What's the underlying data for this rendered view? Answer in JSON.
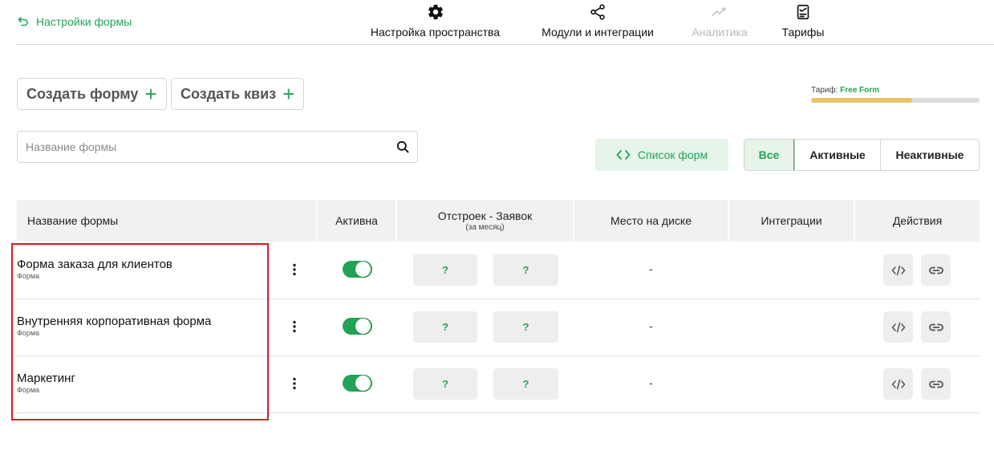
{
  "header": {
    "back_label": "Настройки формы",
    "nav": [
      {
        "label": "Настройка пространства",
        "icon": "gear-icon",
        "disabled": false
      },
      {
        "label": "Модули и интеграции",
        "icon": "share-icon",
        "disabled": false
      },
      {
        "label": "Аналитика",
        "icon": "chart-line-icon",
        "disabled": true
      },
      {
        "label": "Тарифы",
        "icon": "document-icon",
        "disabled": false
      }
    ]
  },
  "actions": {
    "create_form": "Создать форму",
    "create_quiz": "Создать квиз"
  },
  "tariff": {
    "label": "Тариф:",
    "plan": "Free Form",
    "usage_fraction": 0.6,
    "fill_color": "#e8c46a"
  },
  "search": {
    "placeholder": "Название формы",
    "value": ""
  },
  "list_button": "Список форм",
  "filters": [
    {
      "label": "Все",
      "active": true
    },
    {
      "label": "Активные",
      "active": false
    },
    {
      "label": "Неактивные",
      "active": false
    }
  ],
  "table": {
    "columns": [
      {
        "label": "Название формы",
        "sub": ""
      },
      {
        "label": "Активна",
        "sub": ""
      },
      {
        "label": "Отстроек - Заявок",
        "sub": "(за месяц)"
      },
      {
        "label": "Место на диске",
        "sub": ""
      },
      {
        "label": "Интеграции",
        "sub": ""
      },
      {
        "label": "Действия",
        "sub": ""
      }
    ],
    "rows": [
      {
        "name": "Форма заказа для клиентов",
        "type": "Форма",
        "active": true,
        "builds": "?",
        "requests": "?",
        "disk": "-"
      },
      {
        "name": "Внутренняя корпоративная форма",
        "type": "Форма",
        "active": true,
        "builds": "?",
        "requests": "?",
        "disk": "-"
      },
      {
        "name": "Маркетинг",
        "type": "Форма",
        "active": true,
        "builds": "?",
        "requests": "?",
        "disk": "-"
      }
    ]
  },
  "colors": {
    "accent": "#23a455",
    "accent_light": "#e6f4ea",
    "highlight": "#e0161e"
  }
}
